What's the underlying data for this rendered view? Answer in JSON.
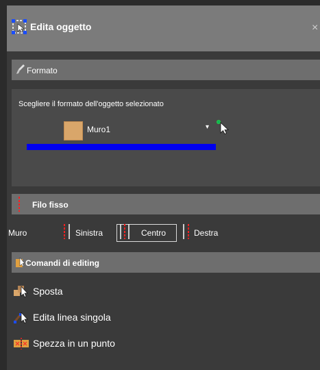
{
  "window": {
    "title": "Edita oggetto",
    "close_glyph": "×"
  },
  "formato": {
    "header": "Formato",
    "description": "Scegliere il formato dell'oggetto selezionato",
    "selected_style": "Muro1",
    "dropdown_glyph": "▾",
    "swatch_color": "#d9a66a",
    "bar_color": "#0000ee"
  },
  "filo_fisso": {
    "header": "Filo fisso",
    "row_label": "Muro",
    "options": [
      {
        "label": "Sinistra",
        "selected": false
      },
      {
        "label": "Centro",
        "selected": true
      },
      {
        "label": "Destra",
        "selected": false
      }
    ]
  },
  "comandi": {
    "header": "Comandi di editing",
    "items": [
      {
        "label": "Sposta",
        "icon": "move-icon"
      },
      {
        "label": "Edita linea singola",
        "icon": "edit-line-icon"
      },
      {
        "label": "Spezza in un punto",
        "icon": "split-icon"
      }
    ]
  }
}
